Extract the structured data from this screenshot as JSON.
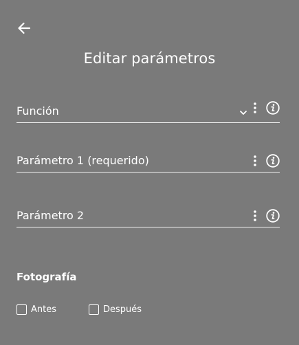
{
  "header": {
    "back_icon": "arrow-left-icon",
    "title": "Editar parámetros"
  },
  "fields": [
    {
      "label": "Función",
      "icons": [
        "chevron-down-icon",
        "more-vertical-icon",
        "info-icon"
      ]
    },
    {
      "label": "Parámetro 1 (requerido)",
      "icons": [
        "more-vertical-icon",
        "info-icon"
      ]
    },
    {
      "label": "Parámetro 2",
      "icons": [
        "more-vertical-icon",
        "info-icon"
      ]
    }
  ],
  "photo_section": {
    "title": "Fotografía",
    "options": [
      {
        "label": "Antes",
        "checked": false
      },
      {
        "label": "Después",
        "checked": false
      }
    ]
  },
  "colors": {
    "background": "#7a7a7a",
    "foreground": "#ffffff"
  }
}
